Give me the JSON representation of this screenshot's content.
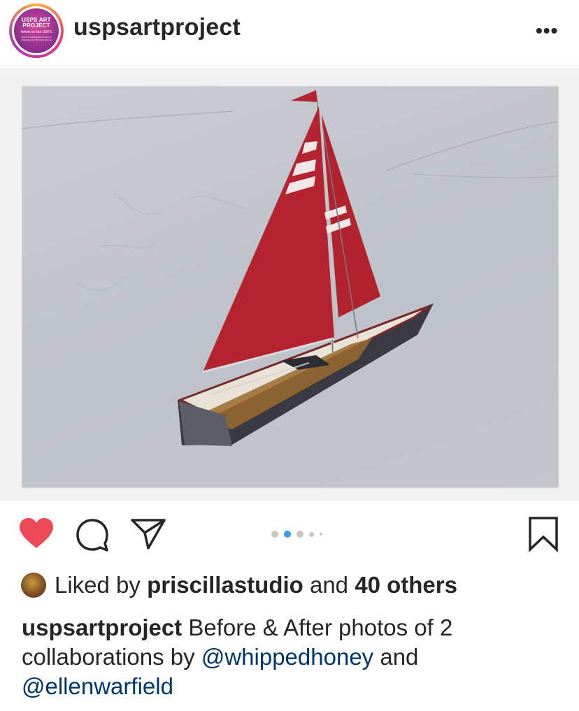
{
  "header": {
    "username": "uspsartproject",
    "more_label": "•••",
    "avatar": {
      "line1": "USPS ART PROJECT",
      "line2": "Artists for the USPS",
      "line3": "Visit our Collaborative Project to Celebrate the US Postal Service"
    }
  },
  "carousel": {
    "slide_count": 5,
    "active_index": 1
  },
  "likes": {
    "prefix": "Liked by ",
    "user": "priscillastudio",
    "middle": " and ",
    "others": "40 others"
  },
  "caption": {
    "author": "uspsartproject",
    "text1": " Before & After photos of 2 collaborations by ",
    "mention1": "@whippedhoney",
    "text2": " and ",
    "mention2": "@ellenwarfield"
  },
  "colors": {
    "like_red": "#ed4956",
    "dot_active": "#3897f0",
    "mention": "#003569"
  },
  "icons": {
    "like": "heart-icon",
    "comment": "comment-icon",
    "share": "paper-plane-icon",
    "save": "bookmark-icon",
    "tag": "user-tag-icon",
    "more": "ellipsis-icon"
  }
}
